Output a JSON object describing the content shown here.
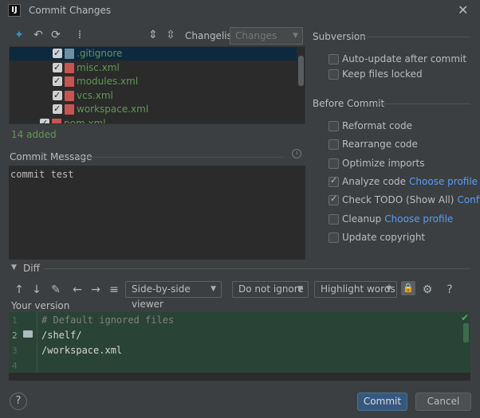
{
  "window": {
    "title": "Commit Changes",
    "app_icon_text": "IJ"
  },
  "toolbar": {
    "changelist_label": "Changelist:",
    "changelist_value": "Changes"
  },
  "tree": {
    "files": [
      {
        "name": ".gitignore",
        "checked": true,
        "selected": true
      },
      {
        "name": "misc.xml",
        "checked": true
      },
      {
        "name": "modules.xml",
        "checked": true
      },
      {
        "name": "vcs.xml",
        "checked": true
      },
      {
        "name": "workspace.xml",
        "checked": true
      },
      {
        "name": "pom.xml",
        "checked": true
      }
    ],
    "summary": "14 added"
  },
  "commit_message": {
    "label": "Commit Message",
    "text": "commit test"
  },
  "subversion": {
    "title": "Subversion",
    "options": [
      {
        "label": "Auto-update after commit",
        "checked": false
      },
      {
        "label": "Keep files locked",
        "checked": false
      }
    ]
  },
  "before_commit": {
    "title": "Before Commit",
    "options": [
      {
        "label": "Reformat code",
        "checked": false,
        "link": ""
      },
      {
        "label": "Rearrange code",
        "checked": false,
        "link": ""
      },
      {
        "label": "Optimize imports",
        "checked": false,
        "link": ""
      },
      {
        "label": "Analyze code",
        "checked": true,
        "link": "Choose profile"
      },
      {
        "label": "Check TODO (Show All)",
        "checked": true,
        "link": "Configure"
      },
      {
        "label": "Cleanup",
        "checked": false,
        "link": "Choose profile"
      },
      {
        "label": "Update copyright",
        "checked": false,
        "link": ""
      }
    ]
  },
  "diff": {
    "label": "Diff",
    "viewer": "Side-by-side viewer",
    "ignore": "Do not ignore",
    "highlight": "Highlight words",
    "help": "?",
    "version_label": "Your version",
    "lines": [
      {
        "num": "1",
        "text": "# Default ignored files",
        "type": "comment"
      },
      {
        "num": "2",
        "text": "/shelf/",
        "type": "text"
      },
      {
        "num": "3",
        "text": "/workspace.xml",
        "type": "text"
      },
      {
        "num": "4",
        "text": "",
        "type": "text"
      }
    ]
  },
  "footer": {
    "help": "?",
    "commit": "Commit",
    "cancel": "Cancel"
  },
  "colors": {
    "background": "#3c3f41",
    "added_green": "#629755",
    "link_blue": "#589df6",
    "diff_bg": "#294436",
    "primary_button": "#365880"
  }
}
